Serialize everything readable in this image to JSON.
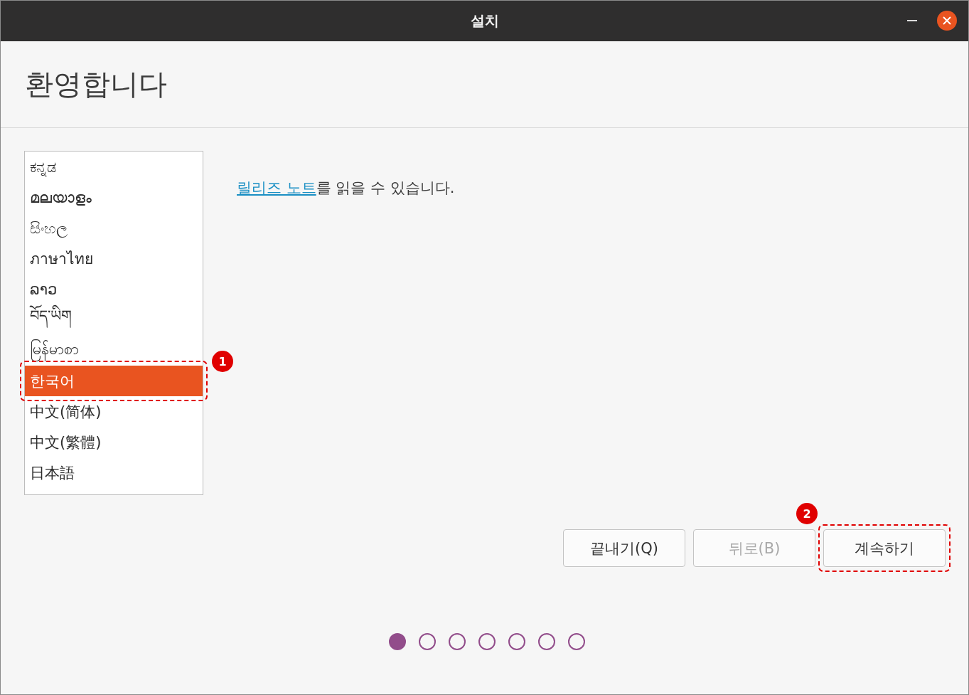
{
  "window": {
    "title": "설치"
  },
  "header": {
    "title": "환영합니다"
  },
  "languages": [
    {
      "label": "ಕನ್ನಡ",
      "selected": false
    },
    {
      "label": "മലയാളം",
      "selected": false
    },
    {
      "label": "සිංහල",
      "selected": false
    },
    {
      "label": "ภาษาไทย",
      "selected": false
    },
    {
      "label": "ລາວ",
      "selected": false
    },
    {
      "label": "བོད་ཡིག",
      "selected": false
    },
    {
      "label": "မြန်မာစာ",
      "selected": false
    },
    {
      "label": "한국어",
      "selected": true,
      "callout": "1"
    },
    {
      "label": "中文(简体)",
      "selected": false
    },
    {
      "label": "中文(繁體)",
      "selected": false
    },
    {
      "label": "日本語",
      "selected": false
    }
  ],
  "notice": {
    "link": "릴리즈 노트",
    "text": "를 읽을 수 있습니다."
  },
  "buttons": [
    {
      "label": "끝내기(Q)",
      "disabled": false
    },
    {
      "label": "뒤로(B)",
      "disabled": true
    },
    {
      "label": "계속하기",
      "disabled": false,
      "callout": "2"
    }
  ],
  "steps": [
    {
      "selected": true
    },
    {
      "selected": false
    },
    {
      "selected": false
    },
    {
      "selected": false
    },
    {
      "selected": false
    },
    {
      "selected": false
    },
    {
      "selected": false
    }
  ]
}
